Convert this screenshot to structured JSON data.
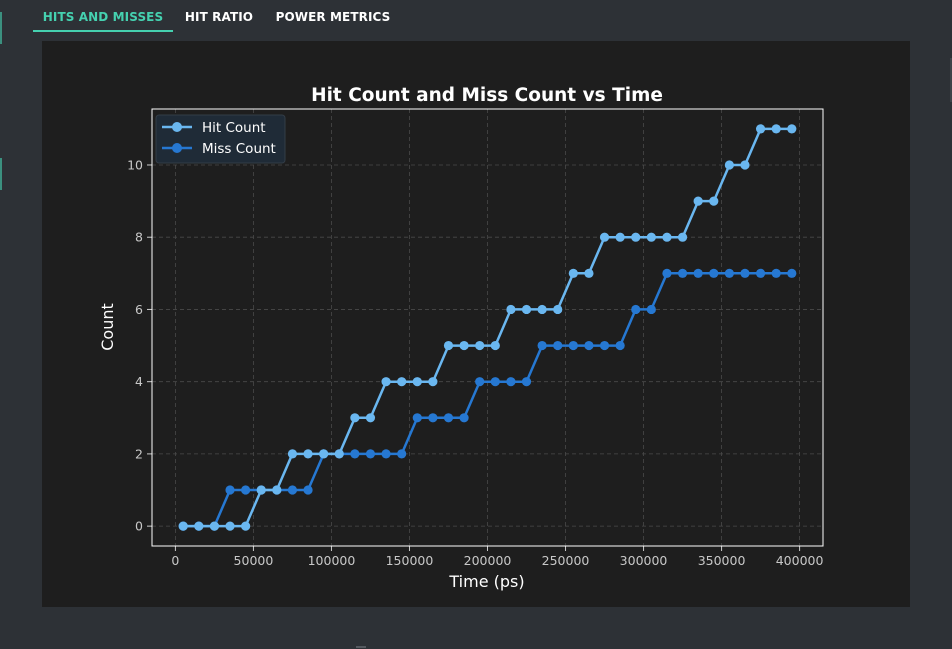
{
  "tabs": [
    {
      "label": "HITS AND MISSES",
      "active": true
    },
    {
      "label": "HIT RATIO",
      "active": false
    },
    {
      "label": "POWER METRICS",
      "active": false
    }
  ],
  "colors": {
    "accent": "#45d1b0",
    "hit_series": "#6ab7f0",
    "miss_series": "#2678d2",
    "plot_background": "#1e1e1e",
    "app_background": "#2d3136"
  },
  "chart_data": {
    "type": "line",
    "title": "Hit Count and Miss Count vs Time",
    "xlabel": "Time (ps)",
    "ylabel": "Count",
    "xlim": [
      -15000,
      415000
    ],
    "ylim": [
      -0.55,
      11.55
    ],
    "x_ticks": [
      0,
      50000,
      100000,
      150000,
      200000,
      250000,
      300000,
      350000,
      400000
    ],
    "y_ticks": [
      0,
      2,
      4,
      6,
      8,
      10
    ],
    "grid": true,
    "legend_position": "top-left",
    "x": [
      5000,
      15000,
      25000,
      35000,
      45000,
      55000,
      65000,
      75000,
      85000,
      95000,
      105000,
      115000,
      125000,
      135000,
      145000,
      155000,
      165000,
      175000,
      185000,
      195000,
      205000,
      215000,
      225000,
      235000,
      245000,
      255000,
      265000,
      275000,
      285000,
      295000,
      305000,
      315000,
      325000,
      335000,
      345000,
      355000,
      365000,
      375000,
      385000,
      395000
    ],
    "series": [
      {
        "name": "Hit Count",
        "values": [
          0,
          0,
          0,
          0,
          0,
          1,
          1,
          2,
          2,
          2,
          2,
          3,
          3,
          4,
          4,
          4,
          4,
          5,
          5,
          5,
          5,
          6,
          6,
          6,
          6,
          7,
          7,
          8,
          8,
          8,
          8,
          8,
          8,
          9,
          9,
          10,
          10,
          11,
          11,
          11
        ]
      },
      {
        "name": "Miss Count",
        "values": [
          0,
          0,
          0,
          1,
          1,
          1,
          1,
          1,
          1,
          2,
          2,
          2,
          2,
          2,
          2,
          3,
          3,
          3,
          3,
          4,
          4,
          4,
          4,
          5,
          5,
          5,
          5,
          5,
          5,
          6,
          6,
          7,
          7,
          7,
          7,
          7,
          7,
          7,
          7,
          7
        ]
      }
    ]
  }
}
